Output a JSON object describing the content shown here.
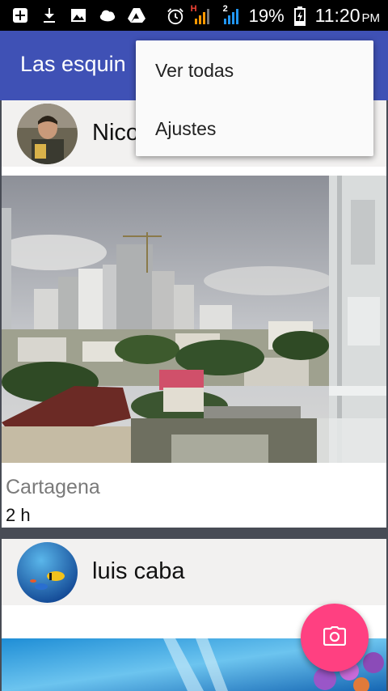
{
  "status_bar": {
    "battery_percent": "19%",
    "time": "11:20",
    "ampm": "PM",
    "network_label": "H",
    "sim_label": "2",
    "icons": [
      "add-box-icon",
      "download-icon",
      "image-icon",
      "cloud-icon",
      "drive-icon",
      "alarm-icon",
      "signal-icon",
      "signal2-icon",
      "battery-icon"
    ]
  },
  "app_bar": {
    "title": "Las esquin"
  },
  "menu": {
    "items": [
      {
        "label": "Ver todas"
      },
      {
        "label": "Ajustes"
      }
    ]
  },
  "feed": {
    "posts": [
      {
        "author": "Nico",
        "place": "Cartagena",
        "time": "2 h"
      },
      {
        "author": "luis caba"
      }
    ]
  },
  "colors": {
    "primary": "#3f51b5",
    "accent": "#ff4081",
    "background": "#484c55"
  },
  "fab": {
    "icon": "camera-icon"
  }
}
